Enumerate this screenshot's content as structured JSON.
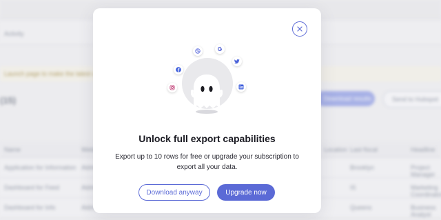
{
  "background": {
    "tab_label": "Activity",
    "banner_text": "Launch page to make the latest upgrade for your team",
    "title": "(15)",
    "primary_btn": "Download results",
    "secondary_btn": "Send to Hubspot",
    "columns": [
      "Name",
      "Website",
      "Location",
      "Last fiscal",
      "Headline"
    ],
    "rows": [
      [
        "Application for Information",
        "Aldrich",
        "Brooklyn",
        "Project Manager"
      ],
      [
        "Dashboard for Feed",
        "Aldrich",
        "IS",
        "Marketing Coordinator"
      ],
      [
        "Dashboard for Info",
        "Aldrich",
        "Queens",
        "Business Analyst"
      ]
    ]
  },
  "modal": {
    "title": "Unlock full export capabilities",
    "description": "Export up to 10 rows for free or upgrade your subscription to export all your data.",
    "download_label": "Download anyway",
    "upgrade_label": "Upgrade now",
    "accent_color": "#5b6ad6",
    "icons": [
      "close-icon",
      "facebook-icon",
      "dribbble-icon",
      "google-icon",
      "twitter-icon",
      "instagram-icon",
      "linkedin-icon",
      "ghost-icon"
    ]
  }
}
